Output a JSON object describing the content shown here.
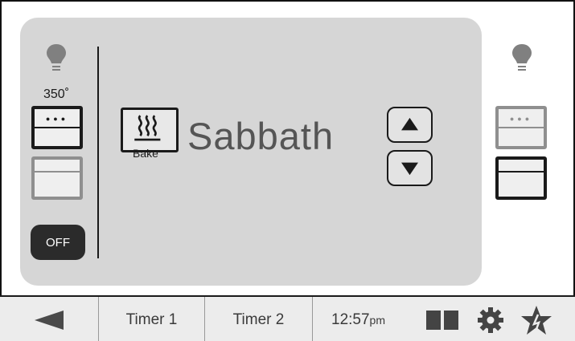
{
  "upper_oven": {
    "temperature": "350˚",
    "off_label": "OFF"
  },
  "mode": {
    "icon": "bake-heat-icon",
    "label": "Bake",
    "name": "Sabbath"
  },
  "nav": {
    "timer1": "Timer 1",
    "timer2": "Timer 2",
    "time": "12:57",
    "time_suffix": "pm"
  },
  "colors": {
    "panel": "#d6d6d6",
    "dark": "#1a1a1a",
    "inactive": "#8f8f8f",
    "off_button": "#2b2b2b"
  }
}
